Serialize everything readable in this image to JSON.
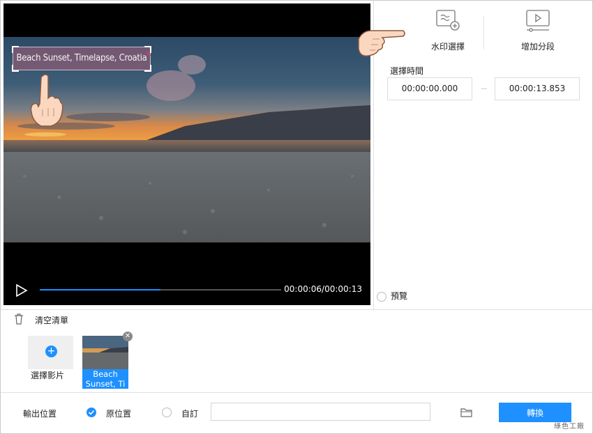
{
  "player": {
    "watermark_text": "Beach Sunset, Timelapse, Croatia",
    "time_display": "00:00:06/00:00:13",
    "progress": 0.5
  },
  "tools": {
    "watermark_label": "水印選擇",
    "add_segment_label": "增加分段"
  },
  "time_select": {
    "title": "選擇時間",
    "start": "00:00:00.000",
    "end": "00:00:13.853"
  },
  "preview_label": "預覽",
  "list": {
    "clear_label": "清空清單",
    "add_label": "選擇影片",
    "items": [
      {
        "name": "Beach Sunset, Ti"
      }
    ]
  },
  "output": {
    "label": "輸出位置",
    "original_label": "原位置",
    "custom_label": "自訂",
    "path_value": "",
    "convert_label": "轉換"
  },
  "brand": "綠色工廠",
  "colors": {
    "accent": "#1e90ff",
    "watermark_bg": "#aa5f78"
  }
}
